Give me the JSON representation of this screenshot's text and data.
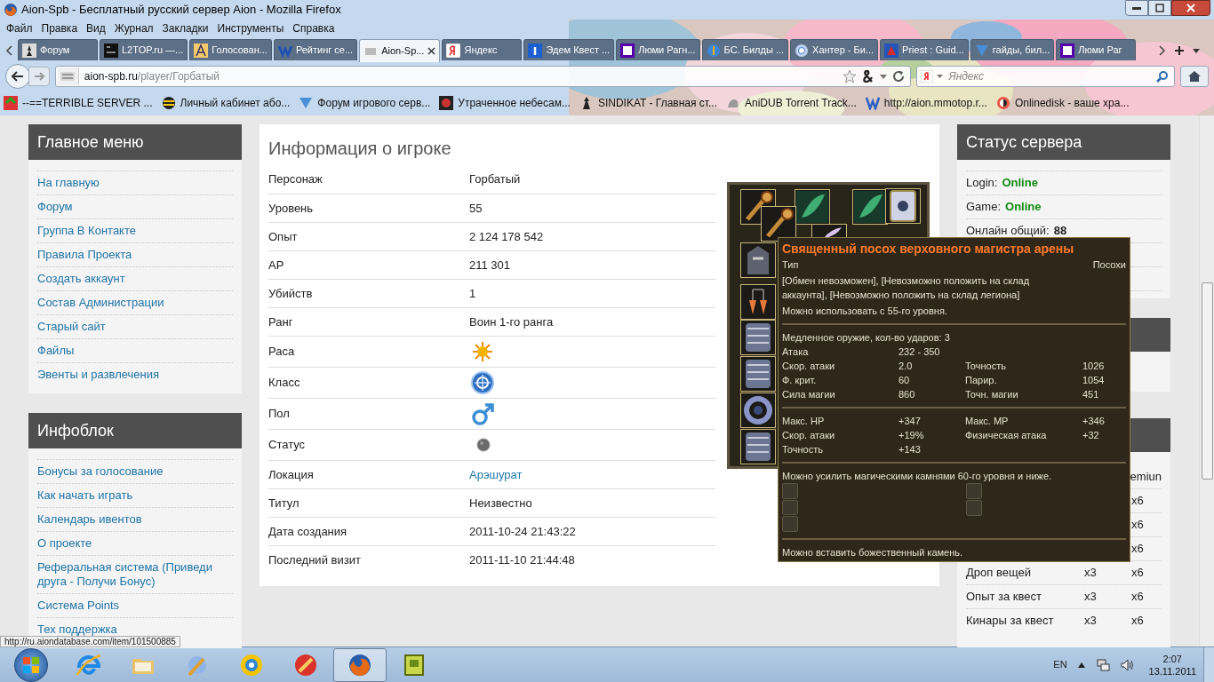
{
  "window": {
    "title": "Aion-Spb - Бесплатный русский сервер Aion - Mozilla Firefox"
  },
  "menu": [
    "Файл",
    "Правка",
    "Вид",
    "Журнал",
    "Закладки",
    "Инструменты",
    "Справка"
  ],
  "tabs": [
    {
      "label": "Форум",
      "selected": false
    },
    {
      "label": "L2TOP.ru —...",
      "selected": false
    },
    {
      "label": "Голосован...",
      "selected": false
    },
    {
      "label": "Рейтинг се...",
      "selected": false
    },
    {
      "label": "Aion-Sp...",
      "selected": true
    },
    {
      "label": "Яндекс",
      "selected": false
    },
    {
      "label": "Эдем Квест ...",
      "selected": false
    },
    {
      "label": "Люми Рагн...",
      "selected": false
    },
    {
      "label": "БС. Билды ...",
      "selected": false
    },
    {
      "label": "Хантер - Би...",
      "selected": false
    },
    {
      "label": "Priest : Guid...",
      "selected": false
    },
    {
      "label": "гайды, бил...",
      "selected": false
    },
    {
      "label": "Люми Раг",
      "selected": false
    }
  ],
  "address_bar": {
    "host": "aion-spb.ru",
    "path": "/player/Горбатый"
  },
  "search": {
    "placeholder": "Яндекс"
  },
  "bookmarks": [
    "--==TERRIBLE SERVER ...",
    "Личный кабинет або...",
    "Форум игрового серв...",
    "Утраченное небесам...",
    "SINDIKAT - Главная ст...",
    "AniDUB Torrent Track...",
    "http://aion.mmotop.r...",
    "Onlinedisk - ваше хра..."
  ],
  "left_sidebar": [
    {
      "title": "Главное меню",
      "items": [
        "На главную",
        "Форум",
        "Группа В Контакте",
        "Правила Проекта",
        "Создать аккаунт",
        "Состав Администрации",
        "Старый сайт",
        "Файлы",
        "Эвенты и развлечения"
      ]
    },
    {
      "title": "Инфоблок",
      "items": [
        "Бонусы за голосование",
        "Как начать играть",
        "Календарь ивентов",
        "О проекте",
        "Реферальная система (Приведи друга - Получи Бонус)",
        "Система Points",
        "Тех поддержка"
      ]
    }
  ],
  "player_info": {
    "title": "Информация о игроке",
    "rows": [
      {
        "label": "Персонаж",
        "kind": "text",
        "value": "Горбатый"
      },
      {
        "label": "Уровень",
        "kind": "text",
        "value": "55"
      },
      {
        "label": "Опыт",
        "kind": "text",
        "value": "2 124 178 542"
      },
      {
        "label": "AP",
        "kind": "text",
        "value": "211 301"
      },
      {
        "label": "Убийств",
        "kind": "text",
        "value": "1"
      },
      {
        "label": "Ранг",
        "kind": "text",
        "value": "Воин 1-го ранга"
      },
      {
        "label": "Раса",
        "kind": "emblem"
      },
      {
        "label": "Класс",
        "kind": "crest"
      },
      {
        "label": "Пол",
        "kind": "gender"
      },
      {
        "label": "Статус",
        "kind": "dot"
      },
      {
        "label": "Локация",
        "kind": "link",
        "value": "Арэшурат"
      },
      {
        "label": "Титул",
        "kind": "text",
        "value": "Неизвестно"
      },
      {
        "label": "Дата создания",
        "kind": "text",
        "value": "2011-10-24 21:43:22"
      },
      {
        "label": "Последний визит",
        "kind": "text",
        "value": "2011-11-10 21:44:48"
      }
    ]
  },
  "tooltip": {
    "title": "Священный посох верховного магистра арены",
    "type_label": "Тип",
    "type_value": "Посохи",
    "restrictions": "[Обмен невозможен], [Невозможно положить на склад аккаунта], [Невозможно положить на склад легиона]",
    "level_note": "Можно использовать с 55-го уровня.",
    "weapon_note": "Медленное оружие, кол-во ударов: 3",
    "stats": [
      [
        "Атака",
        "232 - 350"
      ],
      [
        "Скор. атаки",
        "2.0",
        "Точность",
        "1026"
      ],
      [
        "Ф. крит.",
        "60",
        "Парир.",
        "1054"
      ],
      [
        "Сила магии",
        "860",
        "Точн. магии",
        "451"
      ]
    ],
    "bonuses": [
      [
        "Макс. HP",
        "+347",
        "Макс. MP",
        "+346"
      ],
      [
        "Скор. атаки",
        "+19%",
        "Физическая атака",
        "+32"
      ],
      [
        "Точность",
        "+143"
      ]
    ],
    "enchant_note": "Можно усилить магическими камнями 60-го уровня и ниже.",
    "divine_note": "Можно вставить божественный камень."
  },
  "server_status": {
    "title": "Статус сервера",
    "rows": [
      {
        "label": "Login:",
        "value": "Online",
        "kind": "state"
      },
      {
        "label": "Game:",
        "value": "Online",
        "kind": "state"
      },
      {
        "label": "Онлайн общий:",
        "value": "88",
        "kind": "count"
      }
    ]
  },
  "rates": {
    "header": {
      "column_3": "emiun"
    },
    "rows": [
      {
        "column_3": "x6"
      },
      {
        "column_3": "x6"
      },
      {
        "column_3": "x6"
      },
      {
        "column_1": "Дроп вещей",
        "column_2": "x3",
        "column_3": "x6"
      },
      {
        "column_1": "Опыт за квест",
        "column_2": "x3",
        "column_3": "x6"
      },
      {
        "column_1": "Кинары за квест",
        "column_2": "x3",
        "column_3": "x6"
      }
    ]
  },
  "status_url": "http://ru.aiondatabase.com/item/101500885",
  "taskbar": {
    "apps": [
      {
        "kind": "ie",
        "selected": false
      },
      {
        "kind": "folder",
        "selected": false
      },
      {
        "kind": "tool",
        "selected": false
      },
      {
        "kind": "disc",
        "selected": false
      },
      {
        "kind": "cleaner",
        "selected": false
      },
      {
        "kind": "firefox",
        "selected": true
      },
      {
        "kind": "game",
        "selected": false
      }
    ],
    "language": "EN",
    "time": "2:07",
    "date": "13.11.2011"
  }
}
